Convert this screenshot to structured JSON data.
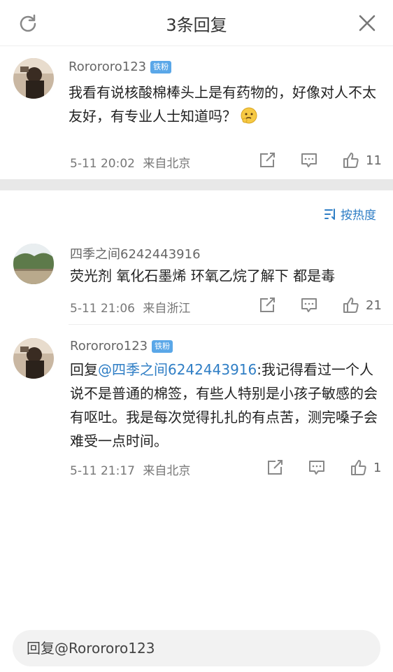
{
  "header": {
    "title": "3条回复",
    "refresh_icon": "refresh-icon",
    "close_icon": "close-icon"
  },
  "main_comment": {
    "username": "Rorororo123",
    "badge": "铁粉",
    "text": "我看有说核酸棉棒头上是有药物的，好像对人不太友好，有专业人士知道吗？",
    "emoji": "thinking-face-emoji",
    "time": "5-11 20:02",
    "location": "来自北京",
    "likes": "11"
  },
  "sort": {
    "label": "按热度",
    "icon": "sort-icon"
  },
  "replies": [
    {
      "username": "四季之间6242443916",
      "badge": "",
      "text": "荧光剂 氧化石墨烯 环氧乙烷了解下 都是毒",
      "time": "5-11 21:06",
      "location": "来自浙江",
      "likes": "21"
    },
    {
      "username": "Rorororo123",
      "badge": "铁粉",
      "prefix": "回复",
      "mention": "@四季之间6242443916",
      "text": ":我记得看过一个人说不是普通的棉签，有些人特别是小孩子敏感的会有呕吐。我是每次觉得扎扎的有点苦，测完嗓子会难受一点时间。",
      "time": "5-11 21:17",
      "location": "来自北京",
      "likes": "1"
    }
  ],
  "reply_input": {
    "placeholder": "回复@Rorororo123"
  },
  "colors": {
    "accent": "#2f7ec5",
    "badge": "#5aa7e8"
  }
}
